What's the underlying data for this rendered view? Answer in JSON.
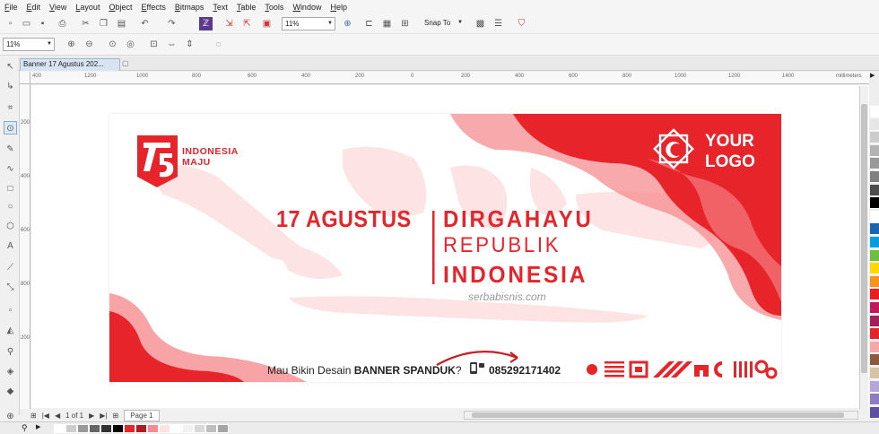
{
  "menu": [
    "File",
    "Edit",
    "View",
    "Layout",
    "Object",
    "Effects",
    "Bitmaps",
    "Text",
    "Table",
    "Tools",
    "Window",
    "Help"
  ],
  "toolbar": {
    "zoom_value": "11%",
    "snap_label": "Snap To"
  },
  "propertybar": {
    "zoom_value": "11%"
  },
  "document_tab": {
    "label": "Banner 17 Agustus 202..."
  },
  "ruler": {
    "h_ticks": [
      "400",
      "1200",
      "1000",
      "800",
      "600",
      "400",
      "200",
      "0",
      "200",
      "400",
      "600",
      "800",
      "1000",
      "1200",
      "1400"
    ],
    "unit": "millimeters",
    "v_ticks": [
      "200",
      "400",
      "600",
      "800",
      "200"
    ]
  },
  "pagination": {
    "current": "1 of 1",
    "page_tab": "Page 1"
  },
  "banner": {
    "logo_text_line1": "INDONESIA",
    "logo_text_line2": "MAJU",
    "your_logo_line1": "YOUR",
    "your_logo_line2": "LOGO",
    "date_text": "17 AGUSTUS",
    "line1": "DIRGAHAYU",
    "line2": "REPUBLIK",
    "line3": "INDONESIA",
    "website": "serbabisnis.com",
    "cta_prefix": "Mau Bikin Desain",
    "cta_bold": "BANNER SPANDUK",
    "cta_suffix": "?",
    "phone": "085292171402"
  },
  "colors": {
    "brand_red": "#e8242b",
    "pink": "#f68c8f",
    "light_pink": "#fde3e3"
  },
  "palette_colors": [
    "#ffffff",
    "#e6e6e6",
    "#cccccc",
    "#b3b3b3",
    "#999999",
    "#808080",
    "#4d4d4d",
    "#000000",
    "#ffffff",
    "#1a64b4",
    "#00a0e0",
    "#6fbf3f",
    "#ffd800",
    "#f7941d",
    "#ed1c24",
    "#c2185b",
    "#a21f5c",
    "#e8242b",
    "#f6a7a9",
    "#8b5a3c",
    "#d9c3a5",
    "#b6a6d9",
    "#8e7cc3",
    "#5e4fa2"
  ],
  "doc_palette": [
    "#ffffff",
    "#cccccc",
    "#999999",
    "#666666",
    "#333333",
    "#000000",
    "#e8242b",
    "#b31b20",
    "#f68c8f",
    "#fde3e3",
    "#ffffff",
    "#f2f2f2",
    "#d9d9d9",
    "#bfbfbf",
    "#a6a6a6"
  ]
}
